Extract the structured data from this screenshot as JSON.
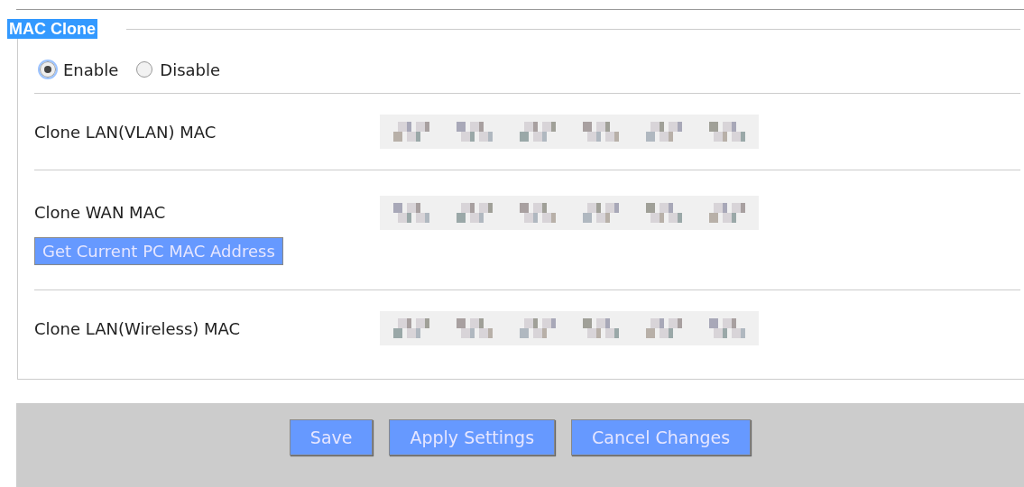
{
  "section": {
    "legend": "MAC Clone"
  },
  "mode": [
    {
      "label": "Enable",
      "selected": true
    },
    {
      "label": "Disable",
      "selected": false
    }
  ],
  "rows": [
    {
      "label": "Clone LAN(VLAN) MAC",
      "redacted": true
    },
    {
      "label": "Clone WAN MAC",
      "redacted": true,
      "button": "Get Current PC MAC Address"
    },
    {
      "label": "Clone LAN(Wireless) MAC",
      "redacted": true
    }
  ],
  "footer_buttons": [
    "Save",
    "Apply Settings",
    "Cancel Changes"
  ]
}
